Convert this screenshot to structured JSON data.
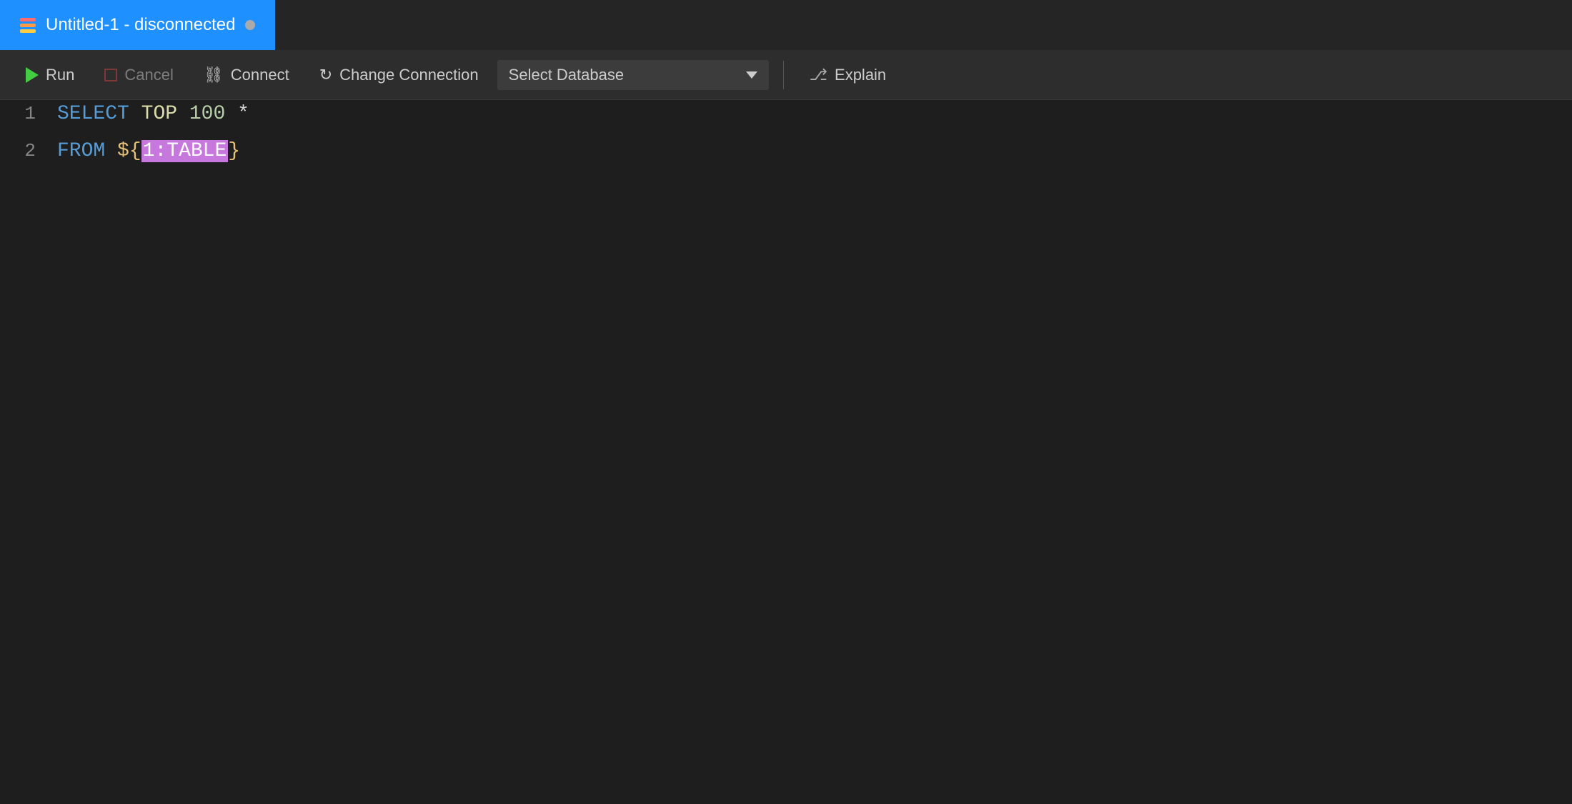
{
  "tab": {
    "title": "Untitled-1 - disconnected",
    "icon_name": "database-icon"
  },
  "toolbar": {
    "run_label": "Run",
    "cancel_label": "Cancel",
    "connect_label": "Connect",
    "change_connection_label": "Change Connection",
    "select_database_placeholder": "Select Database",
    "explain_label": "Explain"
  },
  "editor": {
    "lines": [
      {
        "number": "1",
        "tokens": [
          {
            "type": "kw-blue",
            "text": "SELECT"
          },
          {
            "type": "space",
            "text": " "
          },
          {
            "type": "kw-yellow",
            "text": "TOP"
          },
          {
            "type": "space",
            "text": " "
          },
          {
            "type": "kw-number",
            "text": "100"
          },
          {
            "type": "space",
            "text": " "
          },
          {
            "type": "kw-white",
            "text": "*"
          }
        ]
      },
      {
        "number": "2",
        "tokens": [
          {
            "type": "kw-blue",
            "text": "FROM"
          },
          {
            "type": "space",
            "text": " "
          },
          {
            "type": "snippet-dollar",
            "text": "$"
          },
          {
            "type": "snippet-brace-open",
            "text": "{"
          },
          {
            "type": "snippet-content",
            "text": "1:TABLE"
          },
          {
            "type": "snippet-brace-close",
            "text": "}"
          }
        ]
      }
    ]
  }
}
